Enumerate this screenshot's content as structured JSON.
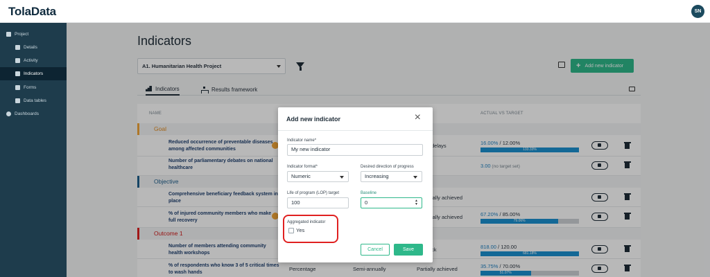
{
  "app": {
    "logo": "TolaData",
    "avatar_initials": "SN"
  },
  "sidebar": {
    "items": [
      {
        "label": "Project",
        "icon": "project-icon"
      },
      {
        "label": "Details",
        "icon": "clipboard-icon"
      },
      {
        "label": "Activity",
        "icon": "list-icon"
      },
      {
        "label": "Indicators",
        "icon": "bar-chart-icon"
      },
      {
        "label": "Forms",
        "icon": "form-icon"
      },
      {
        "label": "Data tables",
        "icon": "table-icon"
      },
      {
        "label": "Dashboards",
        "icon": "dashboard-icon"
      }
    ]
  },
  "page": {
    "title": "Indicators",
    "project_select": "A1. Humanitarian Health Project",
    "add_button": "Add new indicator",
    "tabs": [
      {
        "label": "Indicators"
      },
      {
        "label": "Results framework"
      }
    ]
  },
  "table": {
    "headers": {
      "name": "NAME",
      "actual_vs_target": "ACTUAL VS TARGET"
    },
    "groups": [
      {
        "label": "Goal",
        "color": "#f2a638"
      },
      {
        "label": "Objective",
        "color": "#1e5f8c"
      },
      {
        "label": "Outcome 1",
        "color": "#e02020"
      }
    ],
    "rows": [
      {
        "name": "Reduced occurrence of preventable diseases among affected communities",
        "status": "delays",
        "actual": "16.00%",
        "target": " / 12.00%",
        "fill": 1.0,
        "bar_label": "133.33%"
      },
      {
        "name": "Number of parliamentary debates on national healthcare",
        "status": "",
        "actual": "3.00",
        "target": " (no target set)"
      },
      {
        "name": "Comprehensive beneficiary feedback system in place",
        "status": "ially achieved"
      },
      {
        "name": "% of injured community members who make full recovery",
        "status": "ially achieved",
        "actual": "67.20%",
        "target": " / 85.00%",
        "fill": 0.7906,
        "bar_label": "79.06%"
      },
      {
        "name": "Number of members attending community health workshops",
        "status": "ck",
        "actual": "818.00",
        "target": " / 120.00",
        "fill": 1.0,
        "bar_label": "681.18%"
      },
      {
        "name": "% of respondents who know 3 of 5 critical times to wash hands",
        "format": "Percentage",
        "frequency": "Semi-annually",
        "status": "Partially achieved",
        "actual": "35.75%",
        "target": " / 70.00%",
        "fill": 0.5107,
        "bar_label": "51.07%"
      }
    ]
  },
  "modal": {
    "title": "Add new indicator",
    "name_label": "Indicator name*",
    "name_value": "My new indicator",
    "format_label": "Indicator format*",
    "format_value": "Numeric",
    "direction_label": "Desired direction of progress",
    "direction_value": "Increasing",
    "lop_label": "Life of program (LOP) target",
    "lop_value": "100",
    "baseline_label": "Baseline",
    "baseline_value": "0",
    "aggregated_label": "Aggregated indicator",
    "aggregated_option": "Yes",
    "aggregated_checked": false,
    "cancel": "Cancel",
    "save": "Save"
  }
}
